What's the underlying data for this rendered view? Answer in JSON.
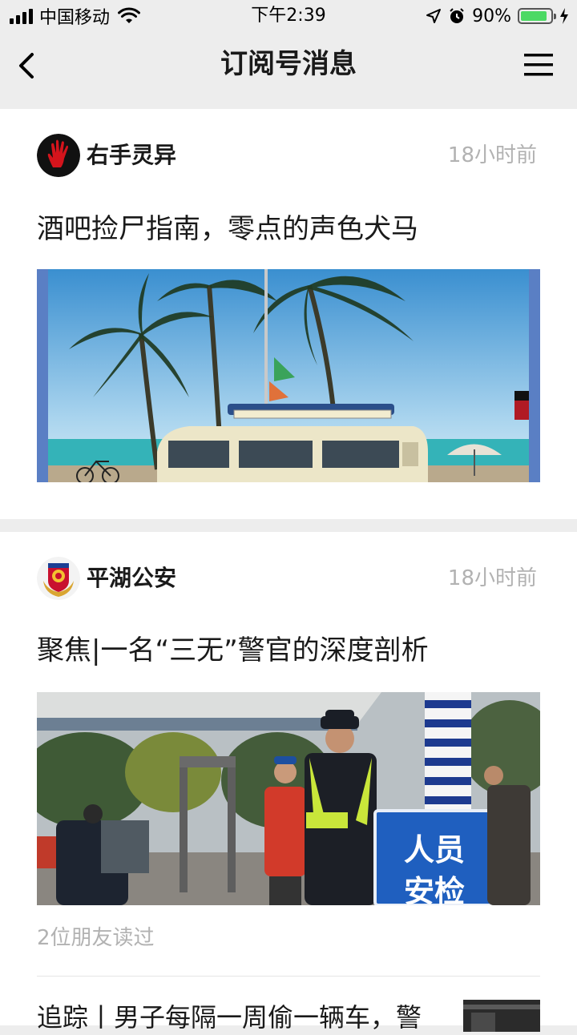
{
  "status_bar": {
    "carrier": "中国移动",
    "time": "下午2:39",
    "battery_percent": "90%",
    "battery_level": 0.9,
    "icons": [
      "signal-icon",
      "wifi-icon",
      "location-icon",
      "alarm-icon",
      "battery-icon",
      "charging-icon"
    ]
  },
  "nav": {
    "title": "订阅号消息",
    "back_icon": "back-chevron-icon",
    "menu_icon": "hamburger-menu-icon"
  },
  "articles": [
    {
      "account": "右手灵异",
      "time_ago": "18小时前",
      "headline": "酒吧捡尸指南，零点的声色犬马",
      "avatar": "red-hand-avatar",
      "cover": "palm-trees-van-beach-image"
    },
    {
      "account": "平湖公安",
      "time_ago": "18小时前",
      "headline": "聚焦|一名“三无”警官的深度剖析",
      "avatar": "police-emblem-avatar",
      "cover": "police-security-check-image",
      "cover_sign_text": "人员\n安检",
      "readers": "2位朋友读过",
      "more_headline": "追踪丨男子每隔一周偷一辆车，警"
    }
  ],
  "colors": {
    "background": "#ededed",
    "card": "#ffffff",
    "muted_text": "#b2b2b2",
    "battery_green": "#4cd964"
  }
}
